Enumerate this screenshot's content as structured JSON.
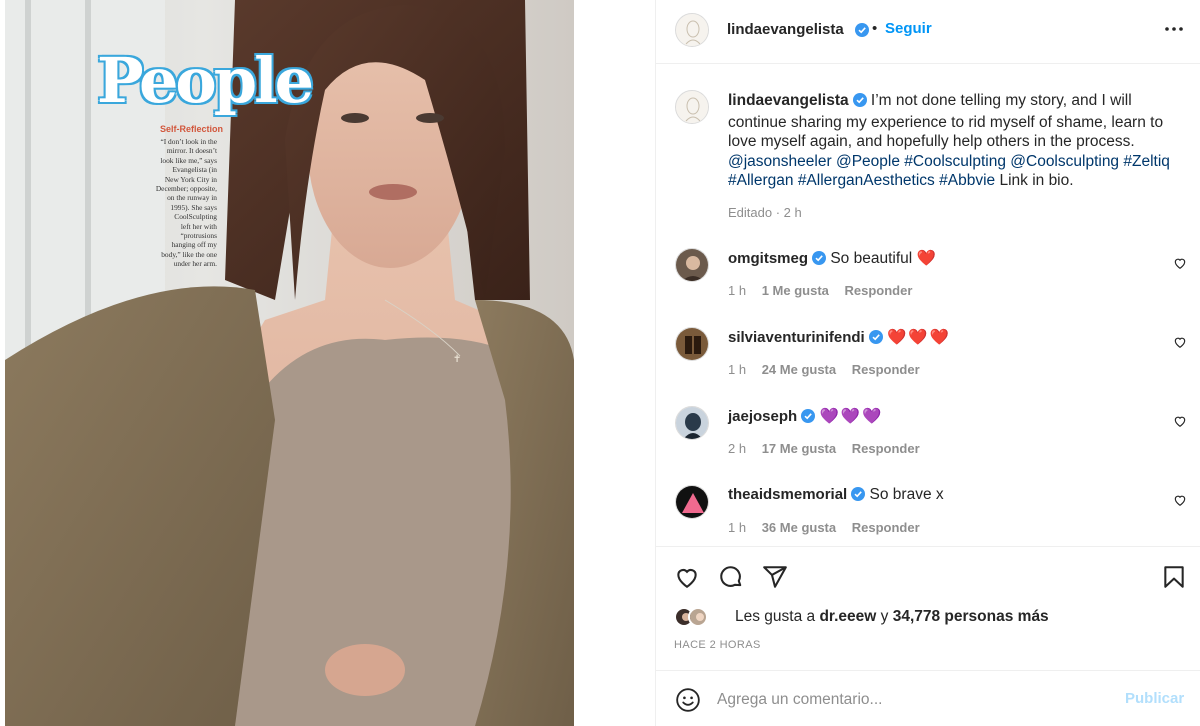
{
  "post_image": {
    "magazine_logo": "People",
    "caption_title": "Self-Reflection",
    "caption_lines": [
      "“I don’t look in the",
      "mirror. It doesn’t",
      "look like me,” says",
      "Evangelista (in",
      "New York City in",
      "December; opposite,",
      "on the runway in",
      "1995). She says",
      "CoolSculpting",
      "left her with",
      "“protrusions",
      "hanging off my",
      "body,” like the one",
      "under her arm."
    ]
  },
  "header": {
    "username": "lindaevangelista",
    "dot": "•",
    "follow_label": "Seguir",
    "more_icon": "more-horizontal-icon"
  },
  "caption": {
    "username": "lindaevangelista",
    "text": "I’m not done telling my story, and I will continue sharing my experience to rid myself of shame, learn to love myself again, and hopefully help others in the process.",
    "tags": [
      "@jasonsheeler",
      "@People",
      "#Coolsculpting",
      "@Coolsculpting",
      "#Zeltiq",
      "#Allergan",
      "#AllerganAesthetics",
      "#Abbvie"
    ],
    "suffix": "Link in bio.",
    "meta": "Editado · 2 h"
  },
  "comments": [
    {
      "username": "omgitsmeg",
      "text": "So beautiful",
      "emoji": "❤️",
      "time": "1 h",
      "likes": "1 Me gusta",
      "reply": "Responder"
    },
    {
      "username": "silviaventurinifendi",
      "text": "",
      "emoji": "❤️❤️❤️",
      "time": "1 h",
      "likes": "24 Me gusta",
      "reply": "Responder"
    },
    {
      "username": "jaejoseph",
      "text": "",
      "emoji": "💜💜💜",
      "time": "2 h",
      "likes": "17 Me gusta",
      "reply": "Responder"
    },
    {
      "username": "theaidsmemorial",
      "text": "So brave x",
      "emoji": "",
      "time": "1 h",
      "likes": "36 Me gusta",
      "reply": "Responder"
    }
  ],
  "actions": {
    "likes_prefix": "Les gusta a",
    "liked_by": "dr.eeew",
    "likes_connector": "y",
    "likes_count": "34,778 personas más",
    "time_ago": "HACE 2 HORAS"
  },
  "add_comment": {
    "placeholder": "Agrega un comentario...",
    "publish_label": "Publicar"
  },
  "colors": {
    "accent": "#0095f6",
    "publish_disabled": "#b2dffc",
    "link": "#00376b",
    "verified": "#3897f0",
    "muted": "#8e8e8e"
  }
}
